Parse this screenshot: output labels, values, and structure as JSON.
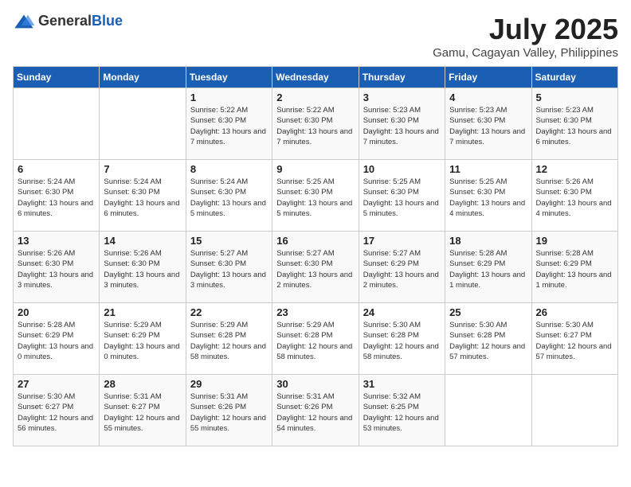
{
  "logo": {
    "general": "General",
    "blue": "Blue"
  },
  "title": "July 2025",
  "subtitle": "Gamu, Cagayan Valley, Philippines",
  "headers": [
    "Sunday",
    "Monday",
    "Tuesday",
    "Wednesday",
    "Thursday",
    "Friday",
    "Saturday"
  ],
  "weeks": [
    [
      {
        "day": "",
        "info": ""
      },
      {
        "day": "",
        "info": ""
      },
      {
        "day": "1",
        "info": "Sunrise: 5:22 AM\nSunset: 6:30 PM\nDaylight: 13 hours and 7 minutes."
      },
      {
        "day": "2",
        "info": "Sunrise: 5:22 AM\nSunset: 6:30 PM\nDaylight: 13 hours and 7 minutes."
      },
      {
        "day": "3",
        "info": "Sunrise: 5:23 AM\nSunset: 6:30 PM\nDaylight: 13 hours and 7 minutes."
      },
      {
        "day": "4",
        "info": "Sunrise: 5:23 AM\nSunset: 6:30 PM\nDaylight: 13 hours and 7 minutes."
      },
      {
        "day": "5",
        "info": "Sunrise: 5:23 AM\nSunset: 6:30 PM\nDaylight: 13 hours and 6 minutes."
      }
    ],
    [
      {
        "day": "6",
        "info": "Sunrise: 5:24 AM\nSunset: 6:30 PM\nDaylight: 13 hours and 6 minutes."
      },
      {
        "day": "7",
        "info": "Sunrise: 5:24 AM\nSunset: 6:30 PM\nDaylight: 13 hours and 6 minutes."
      },
      {
        "day": "8",
        "info": "Sunrise: 5:24 AM\nSunset: 6:30 PM\nDaylight: 13 hours and 5 minutes."
      },
      {
        "day": "9",
        "info": "Sunrise: 5:25 AM\nSunset: 6:30 PM\nDaylight: 13 hours and 5 minutes."
      },
      {
        "day": "10",
        "info": "Sunrise: 5:25 AM\nSunset: 6:30 PM\nDaylight: 13 hours and 5 minutes."
      },
      {
        "day": "11",
        "info": "Sunrise: 5:25 AM\nSunset: 6:30 PM\nDaylight: 13 hours and 4 minutes."
      },
      {
        "day": "12",
        "info": "Sunrise: 5:26 AM\nSunset: 6:30 PM\nDaylight: 13 hours and 4 minutes."
      }
    ],
    [
      {
        "day": "13",
        "info": "Sunrise: 5:26 AM\nSunset: 6:30 PM\nDaylight: 13 hours and 3 minutes."
      },
      {
        "day": "14",
        "info": "Sunrise: 5:26 AM\nSunset: 6:30 PM\nDaylight: 13 hours and 3 minutes."
      },
      {
        "day": "15",
        "info": "Sunrise: 5:27 AM\nSunset: 6:30 PM\nDaylight: 13 hours and 3 minutes."
      },
      {
        "day": "16",
        "info": "Sunrise: 5:27 AM\nSunset: 6:30 PM\nDaylight: 13 hours and 2 minutes."
      },
      {
        "day": "17",
        "info": "Sunrise: 5:27 AM\nSunset: 6:29 PM\nDaylight: 13 hours and 2 minutes."
      },
      {
        "day": "18",
        "info": "Sunrise: 5:28 AM\nSunset: 6:29 PM\nDaylight: 13 hours and 1 minute."
      },
      {
        "day": "19",
        "info": "Sunrise: 5:28 AM\nSunset: 6:29 PM\nDaylight: 13 hours and 1 minute."
      }
    ],
    [
      {
        "day": "20",
        "info": "Sunrise: 5:28 AM\nSunset: 6:29 PM\nDaylight: 13 hours and 0 minutes."
      },
      {
        "day": "21",
        "info": "Sunrise: 5:29 AM\nSunset: 6:29 PM\nDaylight: 13 hours and 0 minutes."
      },
      {
        "day": "22",
        "info": "Sunrise: 5:29 AM\nSunset: 6:28 PM\nDaylight: 12 hours and 58 minutes."
      },
      {
        "day": "23",
        "info": "Sunrise: 5:29 AM\nSunset: 6:28 PM\nDaylight: 12 hours and 58 minutes."
      },
      {
        "day": "24",
        "info": "Sunrise: 5:30 AM\nSunset: 6:28 PM\nDaylight: 12 hours and 58 minutes."
      },
      {
        "day": "25",
        "info": "Sunrise: 5:30 AM\nSunset: 6:28 PM\nDaylight: 12 hours and 57 minutes."
      },
      {
        "day": "26",
        "info": "Sunrise: 5:30 AM\nSunset: 6:27 PM\nDaylight: 12 hours and 57 minutes."
      }
    ],
    [
      {
        "day": "27",
        "info": "Sunrise: 5:30 AM\nSunset: 6:27 PM\nDaylight: 12 hours and 56 minutes."
      },
      {
        "day": "28",
        "info": "Sunrise: 5:31 AM\nSunset: 6:27 PM\nDaylight: 12 hours and 55 minutes."
      },
      {
        "day": "29",
        "info": "Sunrise: 5:31 AM\nSunset: 6:26 PM\nDaylight: 12 hours and 55 minutes."
      },
      {
        "day": "30",
        "info": "Sunrise: 5:31 AM\nSunset: 6:26 PM\nDaylight: 12 hours and 54 minutes."
      },
      {
        "day": "31",
        "info": "Sunrise: 5:32 AM\nSunset: 6:25 PM\nDaylight: 12 hours and 53 minutes."
      },
      {
        "day": "",
        "info": ""
      },
      {
        "day": "",
        "info": ""
      }
    ]
  ]
}
